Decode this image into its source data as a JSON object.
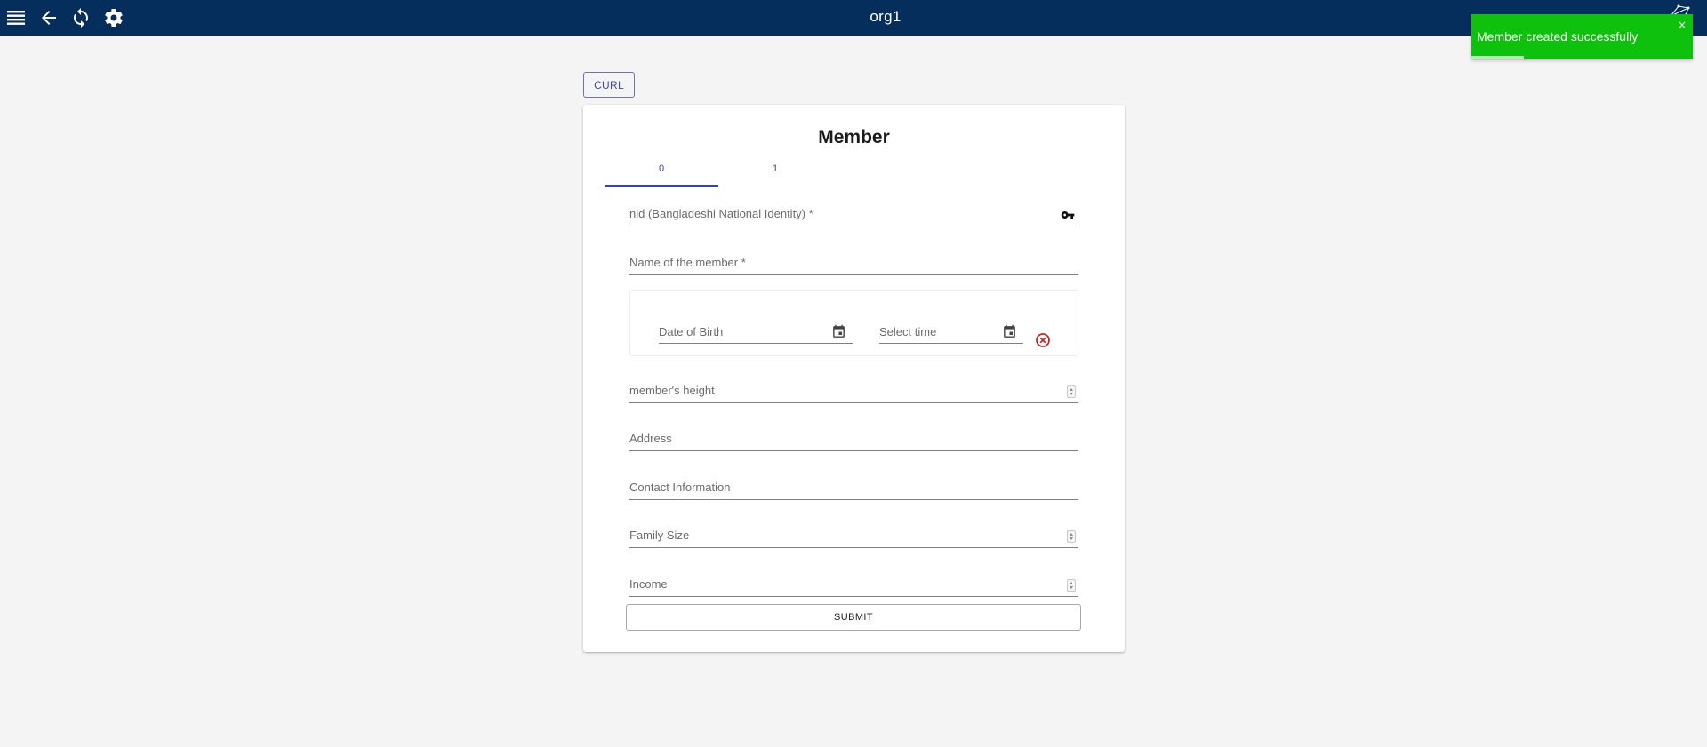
{
  "topbar": {
    "title": "org1",
    "icons": [
      "menu-icon",
      "back-arrow-icon",
      "refresh-icon",
      "settings-gear-icon"
    ]
  },
  "toast": {
    "message": "Member created successfully",
    "close_symbol": "×",
    "color": "#0dc10d"
  },
  "curl_button": {
    "label": "CURL"
  },
  "form": {
    "title": "Member",
    "tabs": [
      {
        "label": "0",
        "active": true
      },
      {
        "label": "1",
        "active": false
      }
    ],
    "fields": {
      "nid": {
        "label": "nid (Bangladeshi National Identity) *",
        "icon": "key-icon"
      },
      "name": {
        "label": "Name of the member *"
      },
      "dob": {
        "label": "Date of Birth",
        "icon": "calendar-icon"
      },
      "time": {
        "label": "Select time",
        "icon": "calendar-icon"
      },
      "height": {
        "label": "member's height"
      },
      "address": {
        "label": "Address"
      },
      "contact": {
        "label": "Contact Information"
      },
      "family_size": {
        "label": "Family Size"
      },
      "income": {
        "label": "Income"
      }
    },
    "submit_label": "SUBMIT"
  },
  "colors": {
    "topbar": "#052e5c",
    "accent": "#3540c8",
    "clear": "#c62828"
  }
}
